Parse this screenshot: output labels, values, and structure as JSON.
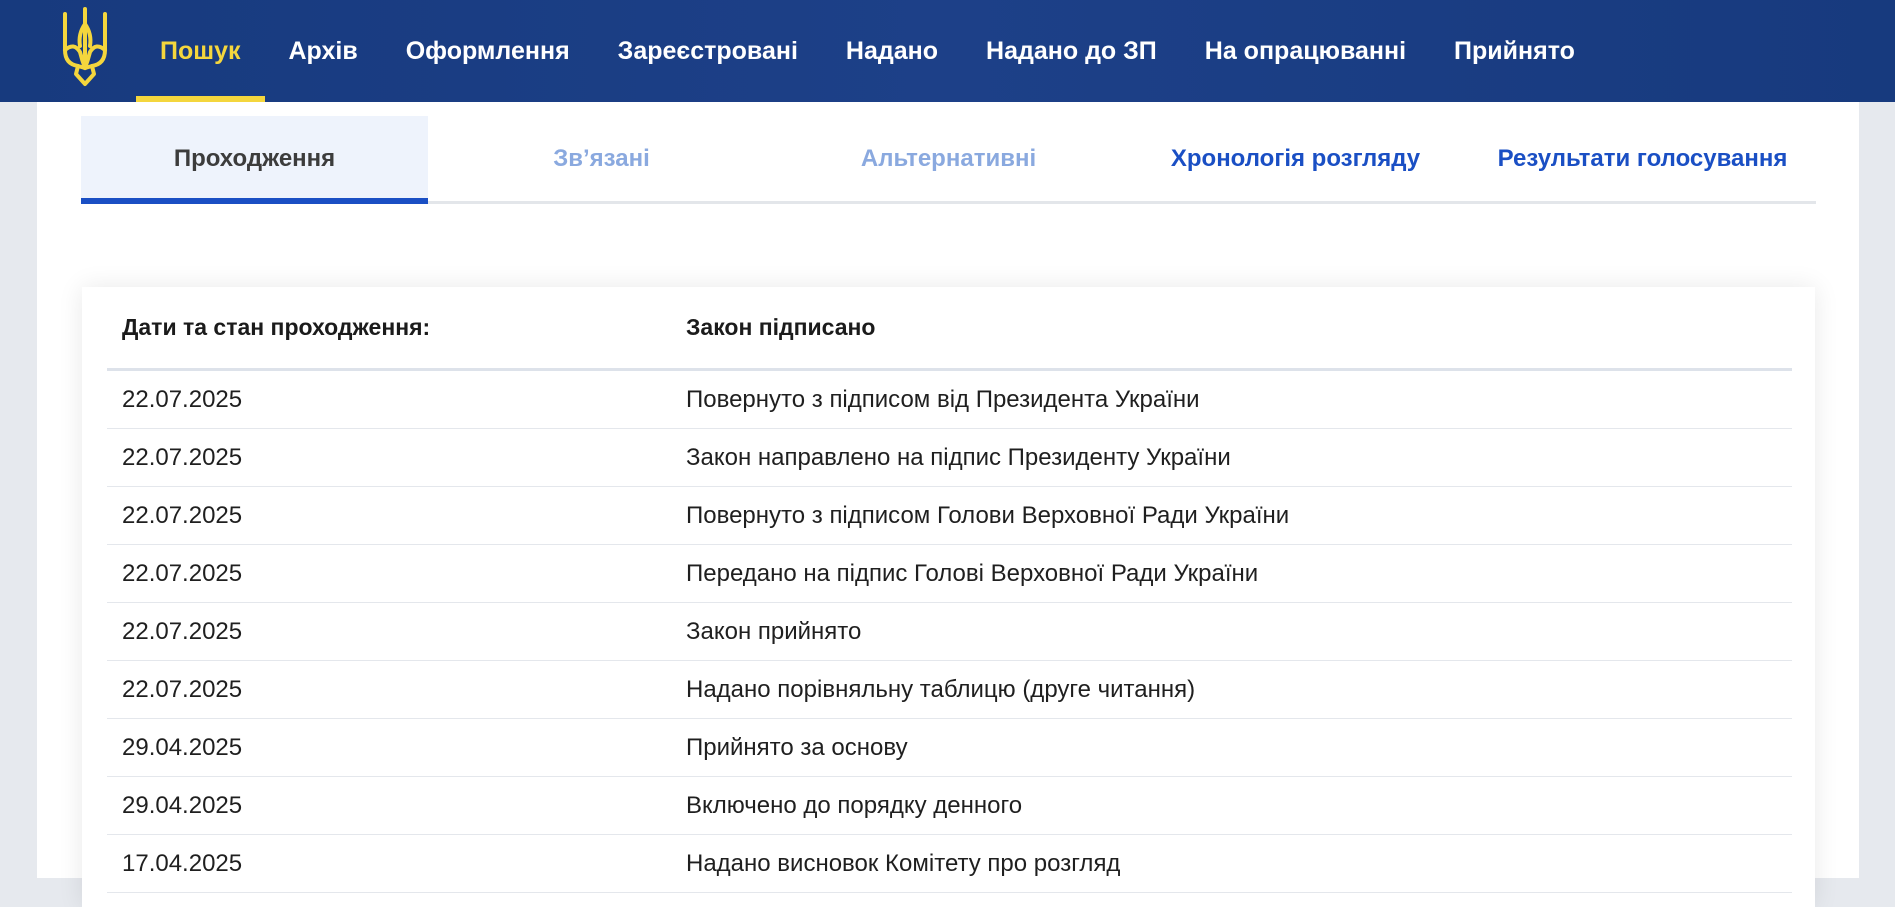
{
  "nav": {
    "items": [
      {
        "label": "Пошук",
        "active": true
      },
      {
        "label": "Архів"
      },
      {
        "label": "Оформлення"
      },
      {
        "label": "Зареєстровані"
      },
      {
        "label": "Надано"
      },
      {
        "label": "Надано до ЗП"
      },
      {
        "label": "На опрацюванні"
      },
      {
        "label": "Прийнято"
      }
    ]
  },
  "tabs": [
    {
      "label": "Проходження",
      "active": true
    },
    {
      "label": "Зв’язані",
      "muted": true
    },
    {
      "label": "Альтернативні",
      "muted": true
    },
    {
      "label": "Хронологія розгляду"
    },
    {
      "label": "Результати голосування"
    }
  ],
  "table": {
    "header_label": "Дати та стан проходження:",
    "header_status": "Закон підписано",
    "rows": [
      {
        "date": "22.07.2025",
        "event": "Повернуто з підписом від Президента України"
      },
      {
        "date": "22.07.2025",
        "event": "Закон направлено на підпис Президенту України"
      },
      {
        "date": "22.07.2025",
        "event": "Повернуто з підписом Голови Верховної Ради України"
      },
      {
        "date": "22.07.2025",
        "event": "Передано на підпис Голові Верховної Ради України"
      },
      {
        "date": "22.07.2025",
        "event": "Закон прийнято"
      },
      {
        "date": "22.07.2025",
        "event": "Надано порівняльну таблицю (друге читання)"
      },
      {
        "date": "29.04.2025",
        "event": "Прийнято за основу"
      },
      {
        "date": "29.04.2025",
        "event": "Включено до порядку денного"
      },
      {
        "date": "17.04.2025",
        "event": "Надано висновок Комітету про розгляд"
      }
    ]
  },
  "colors": {
    "nav_bg": "#1d4088",
    "nav_active": "#f4d63d",
    "tab_accent": "#1a4fc4",
    "tab_muted": "#8aa9df"
  },
  "icons": {
    "logo": "trident-coat-of-arms-icon"
  }
}
